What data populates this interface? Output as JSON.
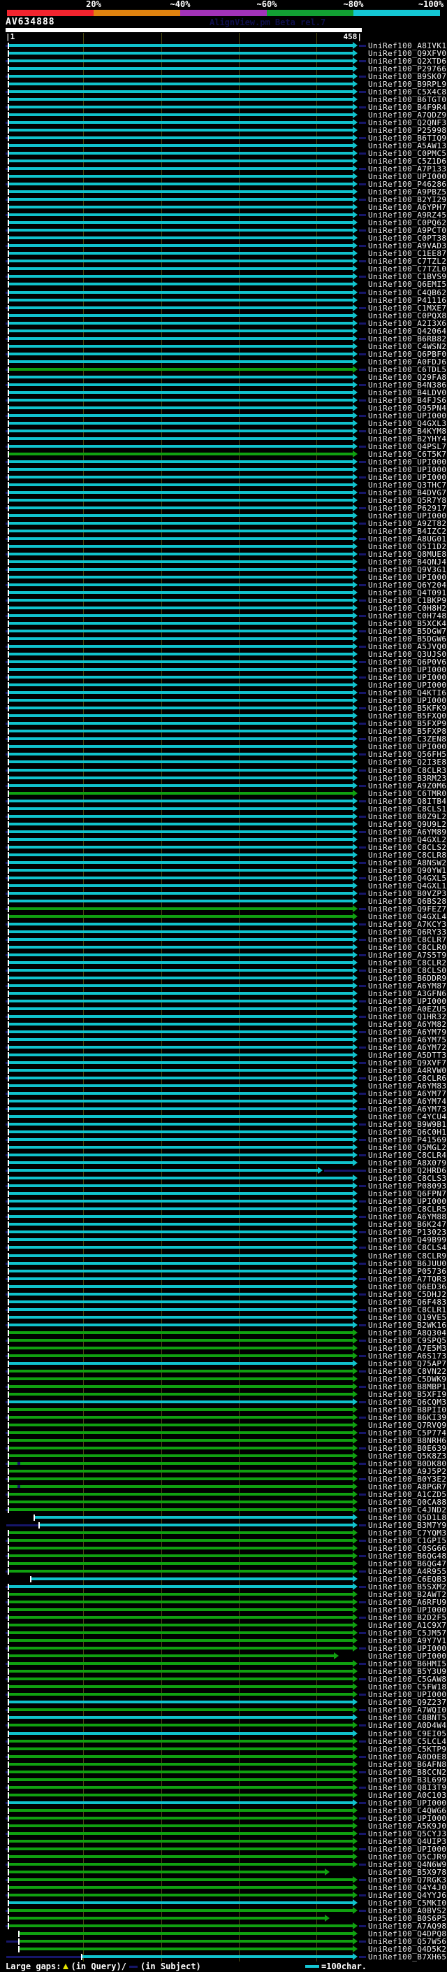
{
  "header": {
    "query_name": "AV634888",
    "watermark": "AlignView.pm Beta rel.7",
    "ruler_start": "|1",
    "ruler_end": "458|"
  },
  "legend": {
    "large_gaps": "Large gaps:",
    "query_gap": "(in Query)/",
    "subject_gap": "(in Subject)",
    "scale_note": "=100char."
  },
  "chart_data": {
    "type": "alignment-overview",
    "query": {
      "name": "AV634888",
      "length": 458
    },
    "identity_scale": [
      {
        "label": "20%",
        "color": "#f2242e"
      },
      {
        "label": "~40%",
        "color": "#e0830f"
      },
      {
        "label": "~60%",
        "color": "#a233b8"
      },
      {
        "label": "~80%",
        "color": "#12a033"
      },
      {
        "label": "~100%",
        "color": "#14c6d4"
      }
    ],
    "colors": {
      "cyan": "#10c2cc",
      "green": "#10a010",
      "navy": "#16166a",
      "grid": "#4c4c12",
      "gap_query": "#e6e600"
    },
    "ruler_gridlines_query_pos": [
      100,
      200,
      300,
      400
    ],
    "label_prefix": "UniRef100_",
    "hits": [
      {
        "id": "A8IVK1",
        "c": "c"
      },
      {
        "id": "Q9XFV0",
        "c": "c"
      },
      {
        "id": "Q2XTD6",
        "c": "c"
      },
      {
        "id": "P29766",
        "c": "c"
      },
      {
        "id": "B9SK07",
        "c": "c"
      },
      {
        "id": "B9RPL9",
        "c": "c"
      },
      {
        "id": "C5X4C8",
        "c": "c"
      },
      {
        "id": "B6TGT0",
        "c": "c"
      },
      {
        "id": "B4F9R4",
        "c": "c"
      },
      {
        "id": "A7QDZ9",
        "c": "c"
      },
      {
        "id": "Q2QNF3",
        "c": "c"
      },
      {
        "id": "P25998",
        "c": "c"
      },
      {
        "id": "B6TIQ9",
        "c": "c"
      },
      {
        "id": "A5AW13",
        "c": "c"
      },
      {
        "id": "C0PMC5",
        "c": "c"
      },
      {
        "id": "C5Z1D6",
        "c": "c"
      },
      {
        "id": "A7P133",
        "c": "c"
      },
      {
        "id": "UPI000..",
        "c": "c"
      },
      {
        "id": "P46286",
        "c": "c"
      },
      {
        "id": "A9PBZ5",
        "c": "c"
      },
      {
        "id": "B2YI29",
        "c": "c"
      },
      {
        "id": "A6YPH7",
        "c": "c"
      },
      {
        "id": "A9RZ45",
        "c": "c"
      },
      {
        "id": "C0PQ62",
        "c": "c"
      },
      {
        "id": "A9PCT0",
        "c": "c"
      },
      {
        "id": "C0PT38",
        "c": "c"
      },
      {
        "id": "A9VAD3",
        "c": "c"
      },
      {
        "id": "C1EE87",
        "c": "c"
      },
      {
        "id": "C7TZL2",
        "c": "c"
      },
      {
        "id": "C7TZL0",
        "c": "c"
      },
      {
        "id": "C1BVS9",
        "c": "c"
      },
      {
        "id": "Q6EMI5",
        "c": "c"
      },
      {
        "id": "C4QB62",
        "c": "c"
      },
      {
        "id": "P41116",
        "c": "c"
      },
      {
        "id": "C1MXE7",
        "c": "c"
      },
      {
        "id": "C0PQX8",
        "c": "c"
      },
      {
        "id": "A2I3X6",
        "c": "c"
      },
      {
        "id": "Q42064",
        "c": "c"
      },
      {
        "id": "B6RB82",
        "c": "c"
      },
      {
        "id": "C4WSN2",
        "c": "c"
      },
      {
        "id": "Q6PBF0",
        "c": "c"
      },
      {
        "id": "A0FDJ6",
        "c": "c"
      },
      {
        "id": "C6TDL5",
        "c": "g"
      },
      {
        "id": "Q29FA8",
        "c": "c"
      },
      {
        "id": "B4N386",
        "c": "c"
      },
      {
        "id": "B4LDV0",
        "c": "c"
      },
      {
        "id": "B4FJS6",
        "c": "c"
      },
      {
        "id": "Q95PN4",
        "c": "c"
      },
      {
        "id": "UPI000..",
        "c": "c"
      },
      {
        "id": "Q4GXL3",
        "c": "c"
      },
      {
        "id": "B4KYM8",
        "c": "c"
      },
      {
        "id": "B2YHY4",
        "c": "c"
      },
      {
        "id": "Q4PSL7",
        "c": "c"
      },
      {
        "id": "C6T5K7",
        "c": "g"
      },
      {
        "id": "UPI000..",
        "c": "c"
      },
      {
        "id": "UPI000..",
        "c": "c"
      },
      {
        "id": "UPI000..",
        "c": "c"
      },
      {
        "id": "Q3THC7",
        "c": "c"
      },
      {
        "id": "B4DVG7",
        "c": "c"
      },
      {
        "id": "Q5R7Y8",
        "c": "c"
      },
      {
        "id": "P62917",
        "c": "c"
      },
      {
        "id": "UPI000..",
        "c": "c"
      },
      {
        "id": "A9ZT82",
        "c": "c"
      },
      {
        "id": "B4IZC2",
        "c": "c"
      },
      {
        "id": "A8UG01",
        "c": "c"
      },
      {
        "id": "Q5I1D2",
        "c": "c"
      },
      {
        "id": "Q8MUE8",
        "c": "c"
      },
      {
        "id": "B4QNJ4",
        "c": "c"
      },
      {
        "id": "Q9V3G1",
        "c": "c"
      },
      {
        "id": "UPI000..",
        "c": "c"
      },
      {
        "id": "Q6Y204",
        "c": "c"
      },
      {
        "id": "Q4T091",
        "c": "c"
      },
      {
        "id": "C1BKP9",
        "c": "c"
      },
      {
        "id": "C0H8H2",
        "c": "c"
      },
      {
        "id": "C0H748",
        "c": "c"
      },
      {
        "id": "B5XCK4",
        "c": "c"
      },
      {
        "id": "B5DGW7",
        "c": "c"
      },
      {
        "id": "B5DGW6",
        "c": "c"
      },
      {
        "id": "A5JVQ0",
        "c": "c"
      },
      {
        "id": "Q3UJS0",
        "c": "c"
      },
      {
        "id": "Q6P0V6",
        "c": "c"
      },
      {
        "id": "UPI000..",
        "c": "c"
      },
      {
        "id": "UPI000..",
        "c": "c"
      },
      {
        "id": "UPI000..",
        "c": "c"
      },
      {
        "id": "Q4KTI6",
        "c": "c"
      },
      {
        "id": "UPI000..",
        "c": "c"
      },
      {
        "id": "B5KFK9",
        "c": "c"
      },
      {
        "id": "B5FXQ0",
        "c": "c"
      },
      {
        "id": "B5FXP9",
        "c": "c"
      },
      {
        "id": "B5FXP8",
        "c": "c"
      },
      {
        "id": "C3ZEN8",
        "c": "c"
      },
      {
        "id": "UPI000..",
        "c": "c"
      },
      {
        "id": "Q56FH5",
        "c": "c"
      },
      {
        "id": "Q2I3E8",
        "c": "c"
      },
      {
        "id": "C8CLR3",
        "c": "c"
      },
      {
        "id": "B3RM23",
        "c": "c"
      },
      {
        "id": "A9Z0M6",
        "c": "c"
      },
      {
        "id": "C6TMR0",
        "c": "g"
      },
      {
        "id": "Q8ITB4",
        "c": "c"
      },
      {
        "id": "C8CLS1",
        "c": "c"
      },
      {
        "id": "B0Z9L2",
        "c": "c"
      },
      {
        "id": "Q9U9L2",
        "c": "c"
      },
      {
        "id": "A6YM89",
        "c": "c"
      },
      {
        "id": "Q4GXL2",
        "c": "c"
      },
      {
        "id": "C8CLS2",
        "c": "c"
      },
      {
        "id": "C8CLR8",
        "c": "c"
      },
      {
        "id": "A8NSW2",
        "c": "c"
      },
      {
        "id": "Q90YW1",
        "c": "c"
      },
      {
        "id": "Q4GXL5",
        "c": "c"
      },
      {
        "id": "Q4GXL1",
        "c": "c"
      },
      {
        "id": "B0VZP3",
        "c": "c"
      },
      {
        "id": "Q6BS28",
        "c": "c"
      },
      {
        "id": "Q9FEZ7",
        "c": "g"
      },
      {
        "id": "Q4GXL4",
        "c": "g"
      },
      {
        "id": "A7KCY3",
        "c": "c"
      },
      {
        "id": "Q6RY33",
        "c": "c"
      },
      {
        "id": "C8CLR7",
        "c": "c"
      },
      {
        "id": "C8CLR0",
        "c": "c"
      },
      {
        "id": "A7S5T9",
        "c": "c"
      },
      {
        "id": "C8CLR2",
        "c": "c"
      },
      {
        "id": "C8CLS0",
        "c": "c"
      },
      {
        "id": "B6DDR9",
        "c": "c"
      },
      {
        "id": "A6YM87",
        "c": "c"
      },
      {
        "id": "A3GFN6",
        "c": "c"
      },
      {
        "id": "UPI000..",
        "c": "c"
      },
      {
        "id": "A0EZU5",
        "c": "c"
      },
      {
        "id": "Q1HR32",
        "c": "c"
      },
      {
        "id": "A6YM82",
        "c": "c"
      },
      {
        "id": "A6YM79",
        "c": "c"
      },
      {
        "id": "A6YM75",
        "c": "c"
      },
      {
        "id": "A6YM72",
        "c": "c"
      },
      {
        "id": "A5DTT3",
        "c": "c"
      },
      {
        "id": "Q9XVF7",
        "c": "c"
      },
      {
        "id": "A4RVW0",
        "c": "c"
      },
      {
        "id": "C8CLR6",
        "c": "c"
      },
      {
        "id": "A6YM83",
        "c": "c"
      },
      {
        "id": "A6YM77",
        "c": "c"
      },
      {
        "id": "A6YM74",
        "c": "c"
      },
      {
        "id": "A6YM73",
        "c": "c"
      },
      {
        "id": "C4YCU4",
        "c": "c"
      },
      {
        "id": "B9W9B1",
        "c": "c"
      },
      {
        "id": "Q6C0H1",
        "c": "c"
      },
      {
        "id": "P41569",
        "c": "c"
      },
      {
        "id": "Q5MGL2",
        "c": "c"
      },
      {
        "id": "C8CLR4",
        "c": "c"
      },
      {
        "id": "A8X079",
        "c": "c"
      },
      {
        "id": "Q2HRD6",
        "c": "c",
        "e": 455
      },
      {
        "id": "C8CLS3",
        "c": "c"
      },
      {
        "id": "P08093",
        "c": "c"
      },
      {
        "id": "Q6FPN7",
        "c": "c"
      },
      {
        "id": "UPI000..",
        "c": "c"
      },
      {
        "id": "C8CLR5",
        "c": "c"
      },
      {
        "id": "A6YM88",
        "c": "c"
      },
      {
        "id": "B6K247",
        "c": "c"
      },
      {
        "id": "P13023",
        "c": "c"
      },
      {
        "id": "Q49B99",
        "c": "c"
      },
      {
        "id": "C8CLS4",
        "c": "c"
      },
      {
        "id": "C8CLR9",
        "c": "c"
      },
      {
        "id": "B6JUU0",
        "c": "c"
      },
      {
        "id": "P05736",
        "c": "c"
      },
      {
        "id": "A7TQR3",
        "c": "c"
      },
      {
        "id": "Q6ED36",
        "c": "c"
      },
      {
        "id": "C5DHJ2",
        "c": "c"
      },
      {
        "id": "Q6F483",
        "c": "c"
      },
      {
        "id": "C8CLR1",
        "c": "c"
      },
      {
        "id": "Q19VE5",
        "c": "c"
      },
      {
        "id": "B2WK16",
        "c": "c"
      },
      {
        "id": "A8Q304",
        "c": "g"
      },
      {
        "id": "C9SPQ5",
        "c": "g"
      },
      {
        "id": "A7E5M3",
        "c": "g"
      },
      {
        "id": "A6S173",
        "c": "g"
      },
      {
        "id": "Q75AP7",
        "c": "c"
      },
      {
        "id": "C8VN22",
        "c": "g"
      },
      {
        "id": "C5DWK9",
        "c": "g"
      },
      {
        "id": "B8MBP1",
        "c": "g"
      },
      {
        "id": "B5XFI9",
        "c": "g"
      },
      {
        "id": "Q6CQM3",
        "c": "c"
      },
      {
        "id": "B8PII0",
        "c": "g"
      },
      {
        "id": "B6KI39",
        "c": "g"
      },
      {
        "id": "Q7RVQ9",
        "c": "g"
      },
      {
        "id": "C5P774",
        "c": "g"
      },
      {
        "id": "B8NRH6",
        "c": "g"
      },
      {
        "id": "B0E639",
        "c": "g"
      },
      {
        "id": "Q5K8Z3",
        "c": "g"
      },
      {
        "id": "B0DK80",
        "c": "g",
        "mk": [
          25
        ]
      },
      {
        "id": "A9J5P2",
        "c": "g"
      },
      {
        "id": "B0Y3E2",
        "c": "g"
      },
      {
        "id": "A8PGR7",
        "c": "g",
        "mk": [
          25
        ]
      },
      {
        "id": "A1CZD5",
        "c": "g"
      },
      {
        "id": "Q0CA88",
        "c": "g"
      },
      {
        "id": "C4JND2",
        "c": "g"
      },
      {
        "id": "Q5D1L8",
        "c": "c",
        "s": 50
      },
      {
        "id": "B3M7Y9",
        "c": "c",
        "s": 57,
        "ln": 1
      },
      {
        "id": "C7YQM3",
        "c": "g"
      },
      {
        "id": "C1GPI5",
        "c": "g"
      },
      {
        "id": "C0SG66",
        "c": "g"
      },
      {
        "id": "B6QG48",
        "c": "g"
      },
      {
        "id": "B6QG47",
        "c": "g"
      },
      {
        "id": "A4R955",
        "c": "g"
      },
      {
        "id": "C6EQB3",
        "c": "c",
        "s": 45
      },
      {
        "id": "B5SXM2",
        "c": "c"
      },
      {
        "id": "B2AWT2",
        "c": "g"
      },
      {
        "id": "A6RFU9",
        "c": "g"
      },
      {
        "id": "UPI000..",
        "c": "g"
      },
      {
        "id": "B2D2F5",
        "c": "g"
      },
      {
        "id": "A1C9X7",
        "c": "g"
      },
      {
        "id": "C5JM57",
        "c": "g"
      },
      {
        "id": "A9Y7V1",
        "c": "g"
      },
      {
        "id": "UPI000..",
        "c": "g"
      },
      {
        "id": "UPI000..",
        "c": "g",
        "e": 478
      },
      {
        "id": "B6HMI5",
        "c": "g"
      },
      {
        "id": "B5Y3U9",
        "c": "g"
      },
      {
        "id": "C5GAW8",
        "c": "g"
      },
      {
        "id": "C5FW18",
        "c": "g"
      },
      {
        "id": "UPI000..",
        "c": "g"
      },
      {
        "id": "Q9Z237",
        "c": "c"
      },
      {
        "id": "A7WQI0",
        "c": "g"
      },
      {
        "id": "C8BNT5",
        "c": "c"
      },
      {
        "id": "A0D4W4",
        "c": "g"
      },
      {
        "id": "C9EI05",
        "c": "c"
      },
      {
        "id": "C5LCL4",
        "c": "g"
      },
      {
        "id": "C5KTP9",
        "c": "g"
      },
      {
        "id": "A0D0E8",
        "c": "g"
      },
      {
        "id": "B6AFN8",
        "c": "g"
      },
      {
        "id": "B8CCN2",
        "c": "g"
      },
      {
        "id": "B3L699",
        "c": "g"
      },
      {
        "id": "Q8I3T9",
        "c": "g"
      },
      {
        "id": "A0C103",
        "c": "g"
      },
      {
        "id": "UPI000..",
        "c": "c"
      },
      {
        "id": "C4QWG6",
        "c": "g"
      },
      {
        "id": "UPI000..",
        "c": "g"
      },
      {
        "id": "A5K9J0",
        "c": "g"
      },
      {
        "id": "Q5CYJ3",
        "c": "g"
      },
      {
        "id": "Q4UIP3",
        "c": "g"
      },
      {
        "id": "UPI000..",
        "c": "g"
      },
      {
        "id": "Q5CJR9",
        "c": "g"
      },
      {
        "id": "Q4N6W9",
        "c": "g"
      },
      {
        "id": "B5X978",
        "c": "g",
        "e": 465
      },
      {
        "id": "Q7RGK3",
        "c": "g"
      },
      {
        "id": "Q4Y4J0",
        "c": "g"
      },
      {
        "id": "Q4YYJ6",
        "c": "g"
      },
      {
        "id": "C5MKI0",
        "c": "c"
      },
      {
        "id": "A0BVS2",
        "c": "g"
      },
      {
        "id": "B0S6P5",
        "c": "g",
        "e": 465
      },
      {
        "id": "A7AQ98",
        "c": "g"
      },
      {
        "id": "Q4DPQ8",
        "c": "g",
        "s": 28
      },
      {
        "id": "Q57W56",
        "c": "g",
        "s": 28,
        "ln": 1
      },
      {
        "id": "Q4D5K2",
        "c": "g",
        "s": 28
      },
      {
        "id": "B7XH65",
        "c": "c",
        "s": 118,
        "ln": 1
      }
    ]
  }
}
